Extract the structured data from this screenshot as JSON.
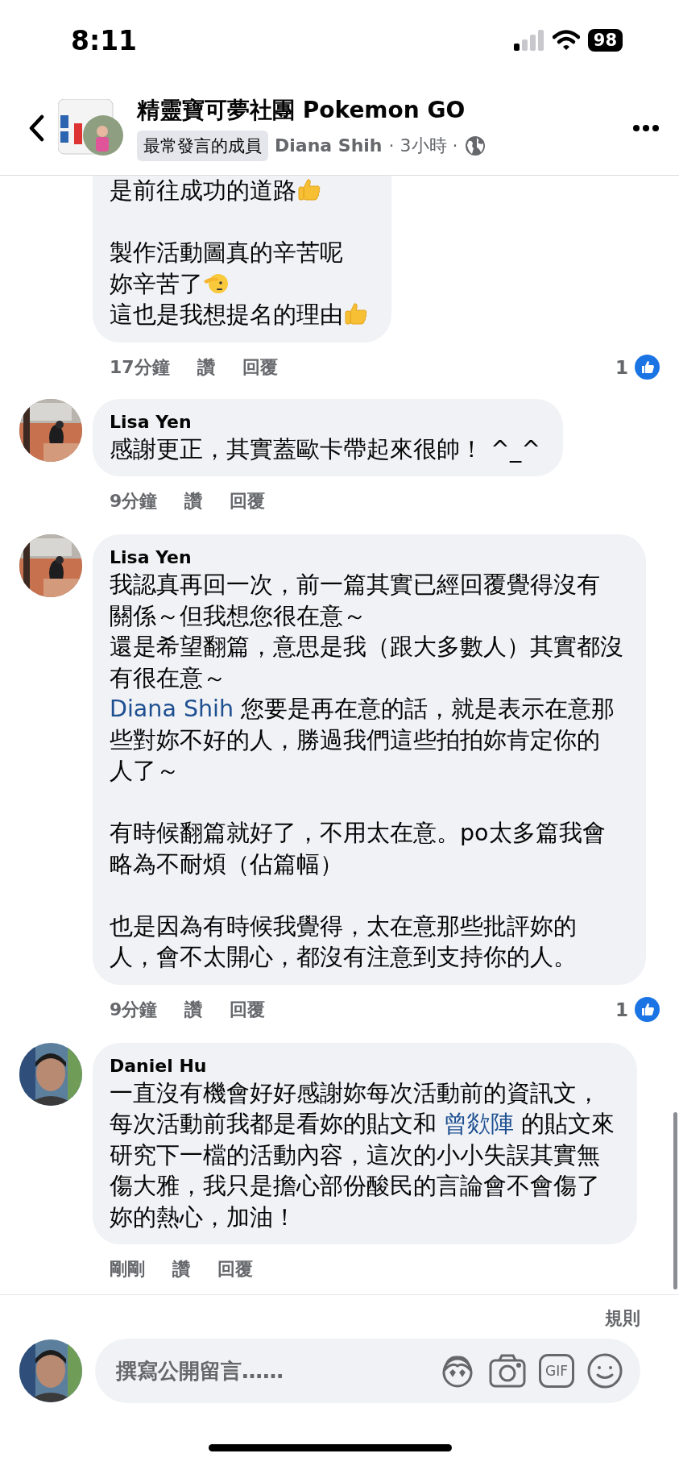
{
  "status_bar": {
    "time": "8:11",
    "battery": "98"
  },
  "header": {
    "title": "精靈寶可夢社團 Pokemon GO",
    "badge": "最常發言的成員",
    "author": "Diana Shih",
    "meta": "· 3小時 ·"
  },
  "comments": [
    {
      "paragraphs": [
        [
          [
            {
              "kind": "text",
              "text": "是前往成功的道路"
            },
            {
              "kind": "thumbs_up"
            }
          ]
        ],
        [
          [
            {
              "kind": "text",
              "text": "製作活動圖真的辛苦呢"
            }
          ],
          [
            {
              "kind": "text",
              "text": "妳辛苦了"
            },
            {
              "kind": "salute"
            }
          ],
          [
            {
              "kind": "text",
              "text": "這也是我想提名的理由"
            },
            {
              "kind": "thumbs_up"
            }
          ]
        ]
      ],
      "time": "17分鐘",
      "like_label": "讚",
      "reply_label": "回覆",
      "likes": "1"
    },
    {
      "author": "Lisa Yen",
      "paragraphs": [
        [
          [
            {
              "kind": "text",
              "text": "感謝更正，其實蓋歐卡帶起來很帥！ ^_^"
            }
          ]
        ]
      ],
      "time": "9分鐘",
      "like_label": "讚",
      "reply_label": "回覆"
    },
    {
      "author": "Lisa Yen",
      "paragraphs": [
        [
          [
            {
              "kind": "text",
              "text": "我認真再回一次，前一篇其實已經回覆覺得沒有"
            }
          ],
          [
            {
              "kind": "text",
              "text": "關係～但我想您很在意～"
            }
          ],
          [
            {
              "kind": "text",
              "text": "還是希望翻篇，意思是我（跟大多數人）其實都沒"
            }
          ],
          [
            {
              "kind": "text",
              "text": "有很在意～"
            }
          ],
          [
            {
              "kind": "mention",
              "text": "Diana Shih"
            },
            {
              "kind": "text",
              "text": " 您要是再在意的話，就是表示在意那"
            }
          ],
          [
            {
              "kind": "text",
              "text": "些對妳不好的人，勝過我們這些拍拍妳肯定你的"
            }
          ],
          [
            {
              "kind": "text",
              "text": "人了～"
            }
          ]
        ],
        [
          [
            {
              "kind": "text",
              "text": "有時候翻篇就好了，不用太在意。po太多篇我會"
            }
          ],
          [
            {
              "kind": "text",
              "text": "略為不耐煩（佔篇幅）"
            }
          ]
        ],
        [
          [
            {
              "kind": "text",
              "text": "也是因為有時候我覺得，太在意那些批評妳的"
            }
          ],
          [
            {
              "kind": "text",
              "text": "人，會不太開心，都沒有注意到支持你的人。"
            }
          ]
        ]
      ],
      "time": "9分鐘",
      "like_label": "讚",
      "reply_label": "回覆",
      "likes": "1"
    },
    {
      "author": "Daniel Hu",
      "paragraphs": [
        [
          [
            {
              "kind": "text",
              "text": "一直沒有機會好好感謝妳每次活動前的資訊文，"
            }
          ],
          [
            {
              "kind": "text",
              "text": "每次活動前我都是看妳的貼文和 "
            },
            {
              "kind": "mention",
              "text": "曾欻陣"
            },
            {
              "kind": "text",
              "text": " 的貼文來"
            }
          ],
          [
            {
              "kind": "text",
              "text": "研究下一檔的活動內容，這次的小小失誤其實無"
            }
          ],
          [
            {
              "kind": "text",
              "text": "傷大雅，我只是擔心部份酸民的言論會不會傷了"
            }
          ],
          [
            {
              "kind": "text",
              "text": "妳的熱心，加油！"
            }
          ]
        ]
      ],
      "time": "剛剛",
      "like_label": "讚",
      "reply_label": "回覆"
    }
  ],
  "composer": {
    "rules": "規則",
    "placeholder": "撰寫公開留言……",
    "gif": "GIF"
  }
}
